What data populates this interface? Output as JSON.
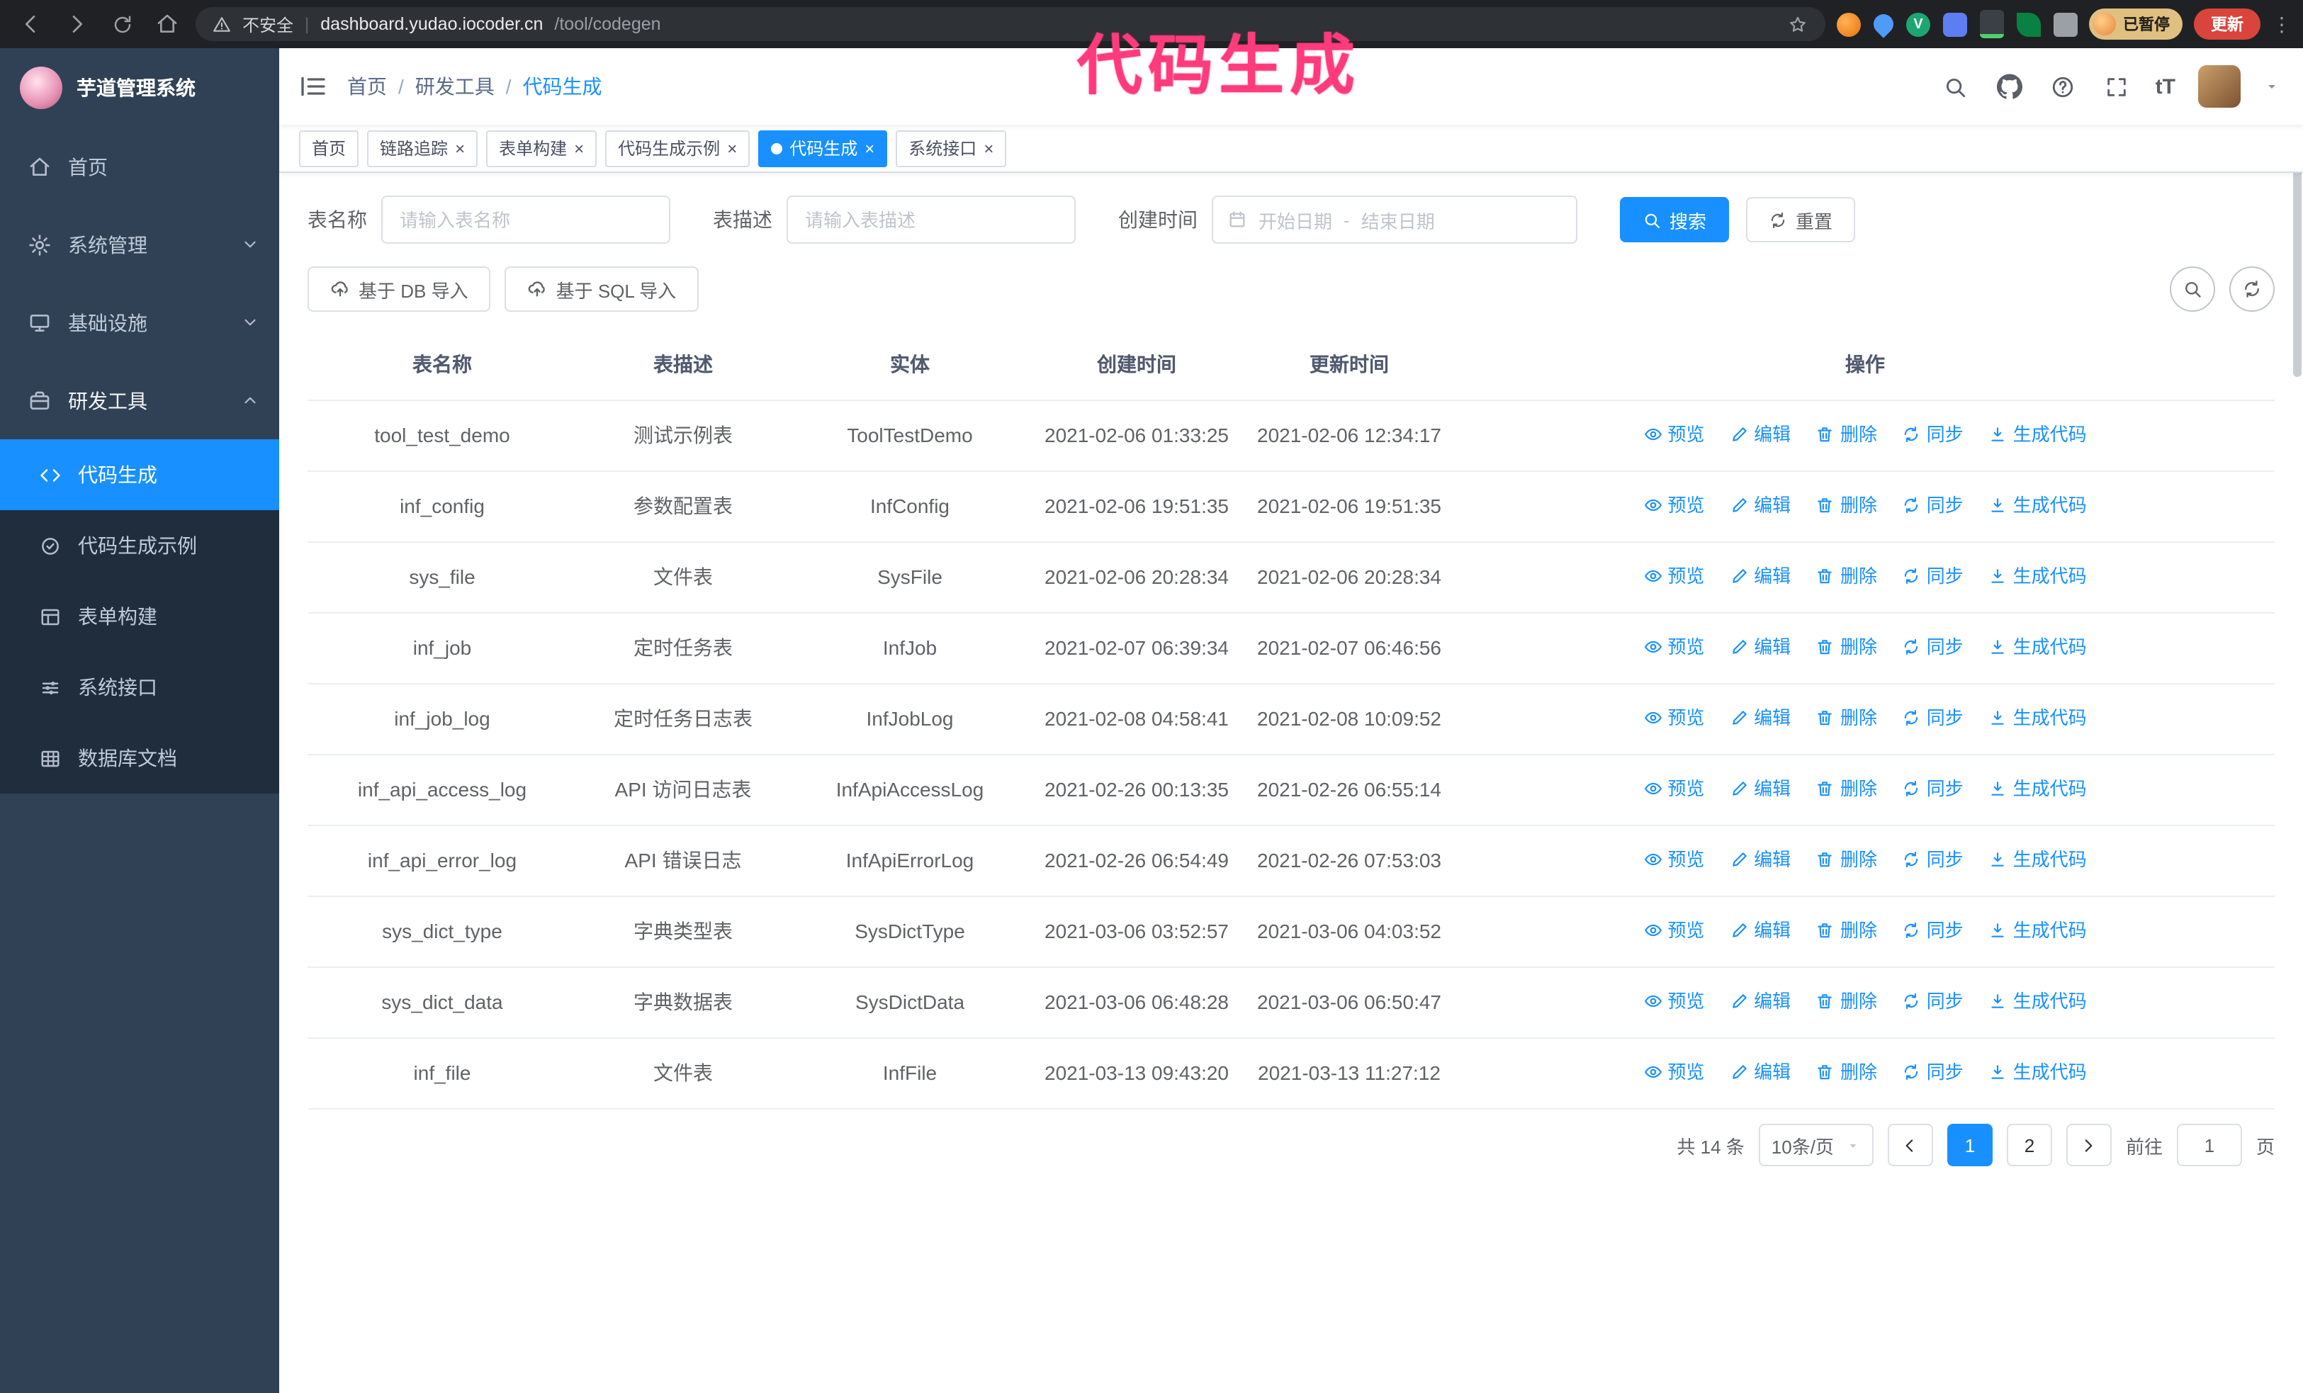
{
  "browser": {
    "security_label": "不安全",
    "url_host": "dashboard.yudao.iocoder.cn",
    "url_path": "/tool/codegen",
    "profile_badge": "已暂停",
    "update_button": "更新"
  },
  "annotation": {
    "text": "代码生成"
  },
  "colors": {
    "accent": "#1890ff",
    "sidebar": "#304156",
    "sidebar_submenu": "#1f2d3d",
    "annotation_pink": "#ff3b7c",
    "update_button_red": "#d9453c",
    "paused_badge_tan": "#dfc081"
  },
  "icons": {
    "close": "×",
    "kebab": "⋮",
    "breadcrumb_sep": "/",
    "url_divider": "|",
    "font_size": "tT",
    "ext_check": "V"
  },
  "sidebar": {
    "app_title": "芋道管理系统",
    "items": [
      {
        "label": "首页"
      },
      {
        "label": "系统管理"
      },
      {
        "label": "基础设施"
      },
      {
        "label": "研发工具"
      }
    ],
    "sub_items": [
      {
        "label": "代码生成"
      },
      {
        "label": "代码生成示例"
      },
      {
        "label": "表单构建"
      },
      {
        "label": "系统接口"
      },
      {
        "label": "数据库文档"
      }
    ]
  },
  "header": {
    "breadcrumb": [
      "首页",
      "研发工具",
      "代码生成"
    ]
  },
  "tabs": [
    {
      "label": "首页"
    },
    {
      "label": "链路追踪"
    },
    {
      "label": "表单构建"
    },
    {
      "label": "代码生成示例"
    },
    {
      "label": "代码生成"
    },
    {
      "label": "系统接口"
    }
  ],
  "filters": {
    "table_name_label": "表名称",
    "table_name_placeholder": "请输入表名称",
    "table_desc_label": "表描述",
    "table_desc_placeholder": "请输入表描述",
    "create_time_label": "创建时间",
    "date_start_placeholder": "开始日期",
    "date_separator": "-",
    "date_end_placeholder": "结束日期",
    "search_button": "搜索",
    "reset_button": "重置"
  },
  "toolbar": {
    "import_db_button": "基于 DB 导入",
    "import_sql_button": "基于 SQL 导入"
  },
  "table": {
    "columns": [
      "表名称",
      "表描述",
      "实体",
      "创建时间",
      "更新时间",
      "操作"
    ],
    "actions": {
      "preview": "预览",
      "edit": "编辑",
      "delete": "删除",
      "sync": "同步",
      "generate": "生成代码"
    },
    "rows": [
      {
        "name": "tool_test_demo",
        "desc": "测试示例表",
        "entity": "ToolTestDemo",
        "created": "2021-02-06 01:33:25",
        "updated": "2021-02-06 12:34:17"
      },
      {
        "name": "inf_config",
        "desc": "参数配置表",
        "entity": "InfConfig",
        "created": "2021-02-06 19:51:35",
        "updated": "2021-02-06 19:51:35"
      },
      {
        "name": "sys_file",
        "desc": "文件表",
        "entity": "SysFile",
        "created": "2021-02-06 20:28:34",
        "updated": "2021-02-06 20:28:34"
      },
      {
        "name": "inf_job",
        "desc": "定时任务表",
        "entity": "InfJob",
        "created": "2021-02-07 06:39:34",
        "updated": "2021-02-07 06:46:56"
      },
      {
        "name": "inf_job_log",
        "desc": "定时任务日志表",
        "entity": "InfJobLog",
        "created": "2021-02-08 04:58:41",
        "updated": "2021-02-08 10:09:52"
      },
      {
        "name": "inf_api_access_log",
        "desc": "API 访问日志表",
        "entity": "InfApiAccessLog",
        "created": "2021-02-26 00:13:35",
        "updated": "2021-02-26 06:55:14"
      },
      {
        "name": "inf_api_error_log",
        "desc": "API 错误日志",
        "entity": "InfApiErrorLog",
        "created": "2021-02-26 06:54:49",
        "updated": "2021-02-26 07:53:03"
      },
      {
        "name": "sys_dict_type",
        "desc": "字典类型表",
        "entity": "SysDictType",
        "created": "2021-03-06 03:52:57",
        "updated": "2021-03-06 04:03:52"
      },
      {
        "name": "sys_dict_data",
        "desc": "字典数据表",
        "entity": "SysDictData",
        "created": "2021-03-06 06:48:28",
        "updated": "2021-03-06 06:50:47"
      },
      {
        "name": "inf_file",
        "desc": "文件表",
        "entity": "InfFile",
        "created": "2021-03-13 09:43:20",
        "updated": "2021-03-13 11:27:12"
      }
    ]
  },
  "pagination": {
    "total": "共 14 条",
    "page_size": "10条/页",
    "page_1": "1",
    "page_2": "2",
    "goto_label": "前往",
    "goto_value": "1",
    "page_unit": "页"
  }
}
